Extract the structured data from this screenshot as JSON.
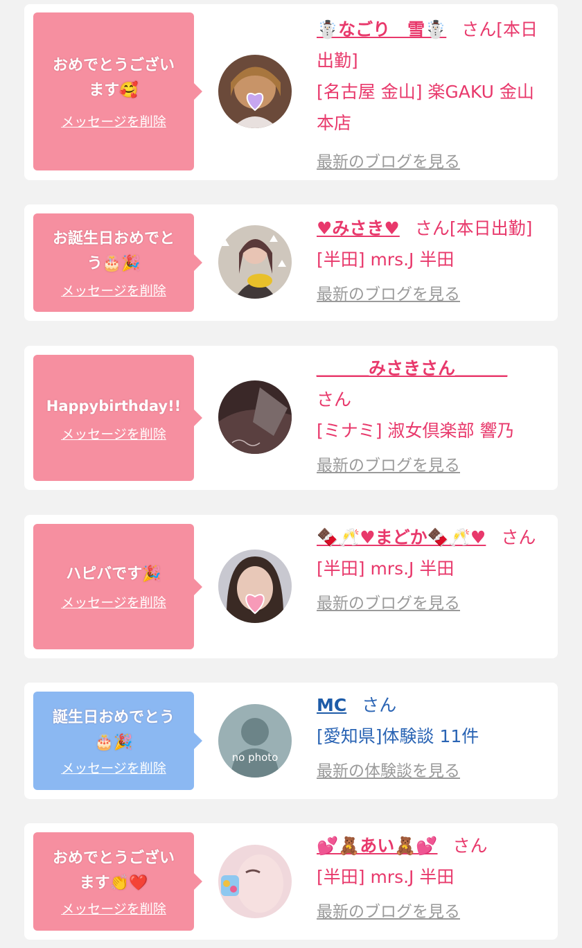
{
  "entries": [
    {
      "message_line1": "おめでとうござい",
      "message_line2": "ます🥰",
      "delete_label": "メッセージを削除",
      "name": "☃️なごり　雪☃️",
      "san": "さん",
      "status": "[本日出勤]",
      "shop": "[名古屋 金山] 楽GAKU 金山本店",
      "blog_link": "最新のブログを見る"
    },
    {
      "message_line1": "お誕生日おめでと",
      "message_line2": "う🎂🎉",
      "delete_label": "メッセージを削除",
      "name": "♥みさき♥",
      "san": "さん",
      "status": "[本日出勤]",
      "shop": "[半田] mrs.J 半田",
      "blog_link": "最新のブログを見る"
    },
    {
      "message_line1": "Happybirthday!!",
      "message_line2": "",
      "delete_label": "メッセージを削除",
      "name": "＿＿＿みさきさん＿＿＿",
      "san": "さん",
      "status": "",
      "shop": "[ミナミ] 淑女倶楽部 響乃",
      "blog_link": "最新のブログを見る"
    },
    {
      "message_line1": "ハピバです🎉",
      "message_line2": "",
      "delete_label": "メッセージを削除",
      "name": "🍫🥂♥まどか🍫🥂♥",
      "san": "さん",
      "status": "",
      "shop": "[半田] mrs.J 半田",
      "blog_link": "最新のブログを見る"
    },
    {
      "message_line1": "誕生日おめでとう",
      "message_line2": "🎂🎉",
      "delete_label": "メッセージを削除",
      "name": "MC",
      "san": "さん",
      "status": "",
      "shop": "[愛知県]体験談 11件",
      "blog_link": "最新の体験談を見る",
      "avatar_text": "no photo"
    },
    {
      "message_line1": "おめでとうござい",
      "message_line2": "ます👏❤️",
      "delete_label": "メッセージを削除",
      "name": "💕🧸あい🧸💕",
      "san": "さん",
      "status": "",
      "shop": "[半田] mrs.J 半田",
      "blog_link": "最新のブログを見る"
    }
  ],
  "colors": {
    "pink_bubble": "#f68fa0",
    "blue_bubble": "#8bb8f2",
    "name_pink": "#e8386b",
    "name_blue": "#1d5ba8",
    "link_gray": "#9a9a9a"
  }
}
